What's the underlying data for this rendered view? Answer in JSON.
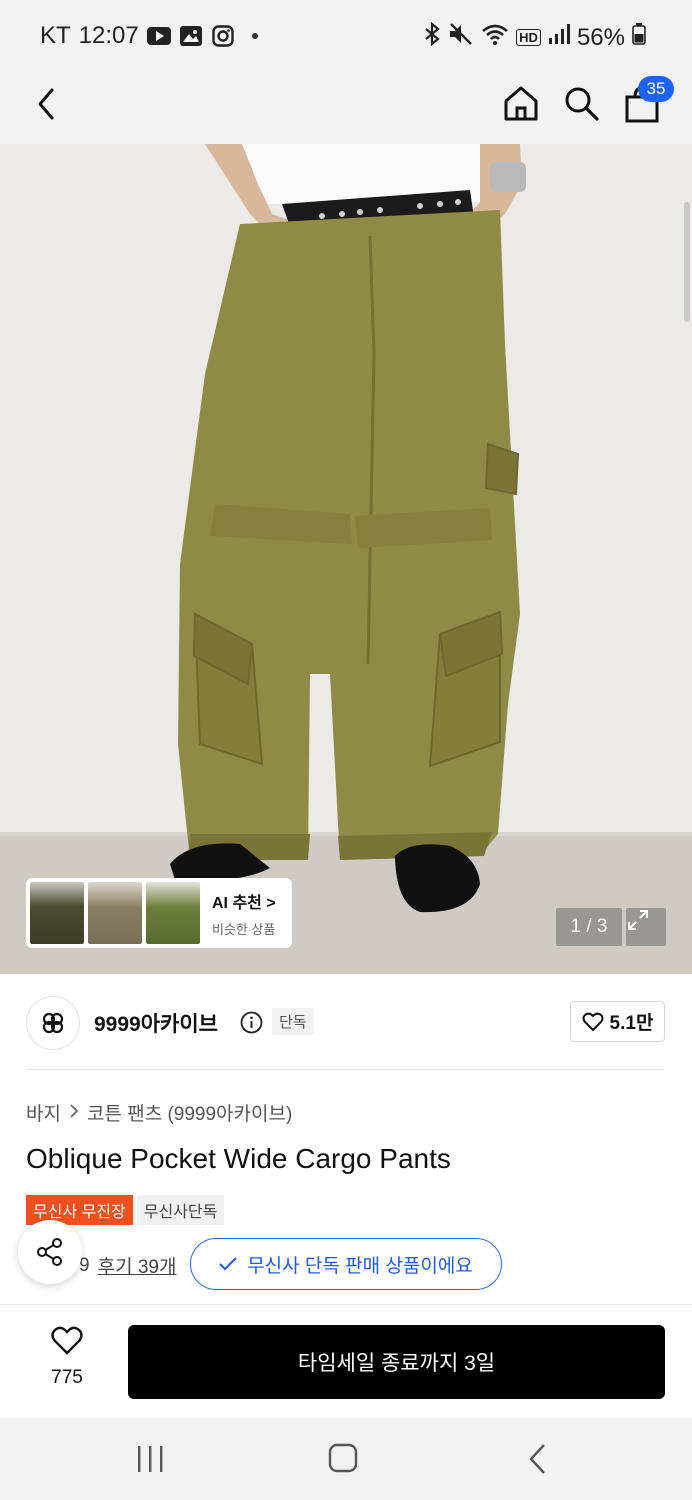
{
  "status_bar": {
    "carrier": "KT",
    "time": "12:07",
    "signal_text": "HD",
    "battery": "56%"
  },
  "header": {
    "cart_count": "35"
  },
  "hero": {
    "ai_title": "AI 추천 >",
    "ai_subtitle": "비슷한 상품",
    "counter": "1 / 3"
  },
  "brand": {
    "name": "9999아카이브",
    "tag": "단독",
    "likes": "5.1만"
  },
  "product": {
    "breadcrumb": [
      "바지",
      "코튼 팬츠 (9999아카이브)"
    ],
    "title": "Oblique Pocket Wide Cargo Pants",
    "tags": [
      "무신사 무진장",
      "무신사단독"
    ],
    "rating_partial": "9",
    "reviews": "후기 39개",
    "exclusive_notice": "무신사 단독 판매 상품이에요"
  },
  "bottom": {
    "wish_count": "775",
    "buy_label": "타임세일 종료까지 3일"
  },
  "colors": {
    "accent_blue": "#1f63ff",
    "tag_red": "#f0501e",
    "pants_olive": "#8f8a45"
  }
}
